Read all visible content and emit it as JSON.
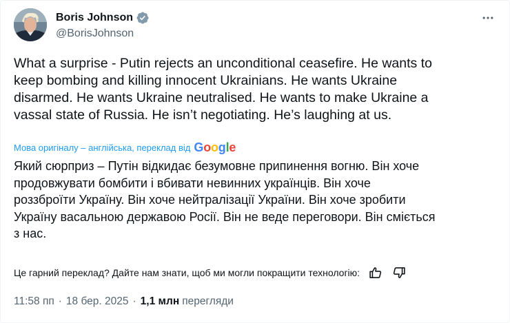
{
  "author": {
    "display_name": "Boris Johnson",
    "handle": "@BorisJohnson",
    "verified": true
  },
  "tweet": {
    "text": "What a surprise - Putin rejects an unconditional ceasefire. He wants to\nkeep bombing and killing innocent Ukrainians. He wants Ukraine\ndisarmed. He wants Ukraine neutralised. He wants to make Ukraine a\nvassal state of Russia. He isn’t negotiating. He’s laughing at us."
  },
  "translation": {
    "source_label": "Мова оригіналу – англійська, переклад від",
    "provider": {
      "letters": [
        "G",
        "o",
        "o",
        "g",
        "l",
        "e"
      ],
      "colors": [
        "#4285f4",
        "#ea4335",
        "#fbbc05",
        "#4285f4",
        "#34a853",
        "#ea4335"
      ]
    },
    "text": "Який сюрприз – Путін відкидає безумовне припинення вогню. Він хоче\nпродовжувати бомбити і вбивати невинних українців. Він хоче\nроззброїти Україну. Він хоче нейтралізації України. Він хоче зробити\nУкраїну васальною державою Росії. Він не веде переговори. Він сміється\nз нас.",
    "feedback_prompt": "Це гарний переклад? Дайте нам знати, щоб ми могли покращити технологію:"
  },
  "meta": {
    "time": "11:58 пп",
    "separator": "·",
    "date": "18 бер. 2025",
    "views_count": "1,1 млн",
    "views_label": "перегляди"
  },
  "icons": {
    "verified": "verified-badge-icon",
    "more": "more-options-icon",
    "thumbs_up": "thumbs-up-icon",
    "thumbs_down": "thumbs-down-icon"
  },
  "colors": {
    "verified_badge": "#829aab",
    "link": "#1d9bf0",
    "secondary_text": "#536471",
    "primary_text": "#0f1419"
  }
}
